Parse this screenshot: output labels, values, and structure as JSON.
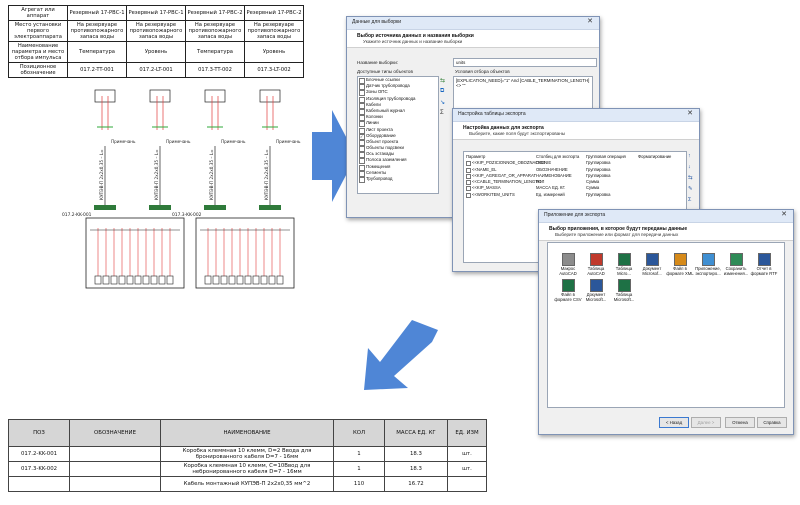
{
  "schematic": {
    "header_rows": [
      {
        "label": "Агрегат или аппарат",
        "values": [
          "Резервный 17-РВС-1",
          "Резервный 17-РВС-1",
          "Резервный 17-РВС-2",
          "Резервный 17-РВС-2"
        ]
      },
      {
        "label": "Место установки первого электроаппарата",
        "values": [
          "На резервуаре противопожарного запаса воды",
          "На резервуаре противопожарного запаса воды",
          "На резервуаре противопожарного запаса воды",
          "На резервуаре противопожарного запаса воды"
        ]
      },
      {
        "label": "Наименование параметра и место отбора импульса",
        "values": [
          "Температура",
          "Уровень",
          "Температура",
          "Уровень"
        ]
      },
      {
        "label": "Позиционное обозначение",
        "values": [
          "017.2-TT-001",
          "017.2-LT-001",
          "017.3-TT-002",
          "017.3-LT-002"
        ]
      }
    ],
    "note_label": "Примечань",
    "boxes": [
      "017.2-KK-001",
      "017.3-KK-002"
    ],
    "cable_label": "КУПЭВ-П 2х2х0,35 – L="
  },
  "dialog1": {
    "title": "Данные для выборки",
    "heading": "Выбор источника данных и названия выборки",
    "subheading": "Укажите источник данных и название выборки",
    "name_label": "Название выборки:",
    "name_value": "units",
    "types_label": "Доступные типы объектов",
    "condition_label": "Условия отбора объектов",
    "condition_text": "[EXPLICATION_NEED]=\"1\" And [CABLE_TERMINATION_LENGTH] <> \"\"",
    "object_types": [
      "Блочные ссылки",
      "Датчик трубопровода",
      "Зоны ОПС",
      "Изоляция трубопровода",
      "Кабели",
      "Кабельный журнал",
      "Колонки",
      "Линии",
      "Лист проекта",
      "Оборудование",
      "Объект проекта",
      "Объекты подсвеки",
      "Ось эстакады",
      "Полоса заземления",
      "Помещения",
      "Сегменты",
      "Трубопровод"
    ],
    "checked_index": 9
  },
  "dialog2": {
    "title": "Настройка таблицы экспорта",
    "heading": "Настройка данных для экспорта",
    "subheading": "Выберите, какие поля будут экспортированы",
    "columns": [
      "Параметр",
      "Столбец для экспорта",
      "Групповая операция",
      "Форматирование"
    ],
    "rows": [
      {
        "param": "<<KIP_POZICIONNOE_OBOZNACHENIE",
        "col": "ПОЗ",
        "op": "Группировка"
      },
      {
        "param": "<<NAME_EL",
        "col": "ОБОЗНАЧЕНИЕ",
        "op": "Группировка"
      },
      {
        "param": "<<KIP_AGREGAT_OR_APPARAT",
        "col": "НАИМЕНОВАНИЕ",
        "op": "Группировка"
      },
      {
        "param": "<<CABLE_TERMINATION_LENGTH",
        "col": "КОЛ",
        "op": "Сумма"
      },
      {
        "param": "<<KIP_MASSA",
        "col": "МАССА ЕД. КГ.",
        "op": "Сумма"
      },
      {
        "param": "<<WORKITEM_UNITS",
        "col": "Ед. измерений",
        "op": "Группировка"
      }
    ]
  },
  "dialog3": {
    "title": "Приложение для экспорта",
    "heading": "Выбор приложения, в которое будут переданы данные",
    "subheading": "Выберите приложение или формат для передачи данных",
    "apps": [
      {
        "label": "Макрос AutoCAD",
        "color": "#8c8c8c"
      },
      {
        "label": "Таблица AutoCAD",
        "color": "#c0392b"
      },
      {
        "label": "Таблица Micro...",
        "color": "#1e7145"
      },
      {
        "label": "Документ Microsof...",
        "color": "#2b579a"
      },
      {
        "label": "Файл в формате XML",
        "color": "#d68a1a"
      },
      {
        "label": "Приложение, экспортиро...",
        "color": "#3f8fd2"
      },
      {
        "label": "Сохранить изменения...",
        "color": "#2e8b57"
      },
      {
        "label": "Отчет в формате RTF",
        "color": "#2b579a"
      },
      {
        "label": "Файл в формате CSV",
        "color": "#1e7145"
      },
      {
        "label": "Документ Microsoft...",
        "color": "#2b579a"
      },
      {
        "label": "Таблица Microsoft...",
        "color": "#1e7145"
      }
    ],
    "buttons": {
      "back": "< Назад",
      "next": "Далее >",
      "cancel": "Отмена",
      "help": "Справка"
    }
  },
  "spec_table": {
    "headers": [
      "ПОЗ",
      "ОБОЗНАЧЕНИЕ",
      "НАИМЕНОВАНИЕ",
      "КОЛ",
      "МАССА ЕД. КГ",
      "ЕД. ИЗМ"
    ],
    "rows": [
      [
        "017.2-KK-001",
        "",
        "Коробка клеммная 10 клемм, D=2 Ввода для бронированного кабеля D=7 - 16мм",
        "1",
        "18.3",
        "шт."
      ],
      [
        "017.3-KK-002",
        "",
        "Коробка клеммная 10 клемм, С=10Ввод для небронированного кабеля D=7 - 16мм",
        "1",
        "18.3",
        "шт."
      ],
      [
        "",
        "",
        "Кабель монтажный КУПЭВ-П 2х2х0,35 мм^2",
        "110",
        "16.72",
        ""
      ]
    ]
  },
  "colors": {
    "arrow": "#4f86d6",
    "cable": "#e23b3b",
    "terminal_green": "#2faa3a"
  }
}
